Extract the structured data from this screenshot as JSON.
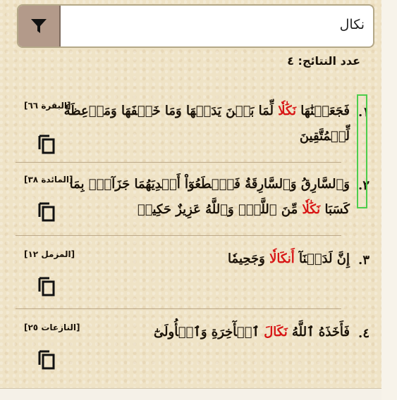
{
  "search": {
    "value": "نكال",
    "placeholder": ""
  },
  "results_count_label": "عدد النتائج: ٤",
  "colors": {
    "highlight": "#d81616",
    "selection_outline": "#4ccd4c",
    "filter_button": "#b39a8a"
  },
  "results": [
    {
      "number": "١.",
      "verse_before": "فَجَعَلۡنَٰهَا ",
      "verse_highlight": "نَكَٰلٗا",
      "verse_after": " لِّمَا بَيۡنَ يَدَيۡهَا وَمَا خَلۡفَهَا وَمَوۡعِظَةٗ",
      "verse_line2": "لِّلۡمُتَّقِينَ",
      "reference": "[البقرة ٦٦]",
      "copy_icon": "copy-icon"
    },
    {
      "number": "٢.",
      "verse_before": "وَٱلسَّارِقُ وَٱلسَّارِقَةُ فَٱقۡطَعُوٓاْ أَيۡدِيَهُمَا جَزَآءَۢ بِمَا",
      "verse_line2_before": "كَسَبَا ",
      "verse_highlight": "نَكَٰلٗا",
      "verse_line2_after": " مِّنَ ٱللَّهِۗ وَٱللَّهُ عَزِيزٌ حَكِيمٞ",
      "reference": "[المائدة ٣٨]",
      "copy_icon": "copy-icon"
    },
    {
      "number": "٣.",
      "verse_before": "إِنَّ لَدَيۡنَآ ",
      "verse_highlight": "أَنكَالٗا",
      "verse_after": " وَجَحِيمٗا",
      "reference": "[المزمل ١٢]",
      "copy_icon": "copy-icon"
    },
    {
      "number": "٤.",
      "verse_before": "فَأَخَذَهُ ٱللَّهُ ",
      "verse_highlight": "نَكَالَ",
      "verse_after": " ٱلۡأٓخِرَةِ وَٱلۡأُولَىٰٓ",
      "reference": "[النازعات ٢٥]",
      "copy_icon": "copy-icon"
    }
  ]
}
